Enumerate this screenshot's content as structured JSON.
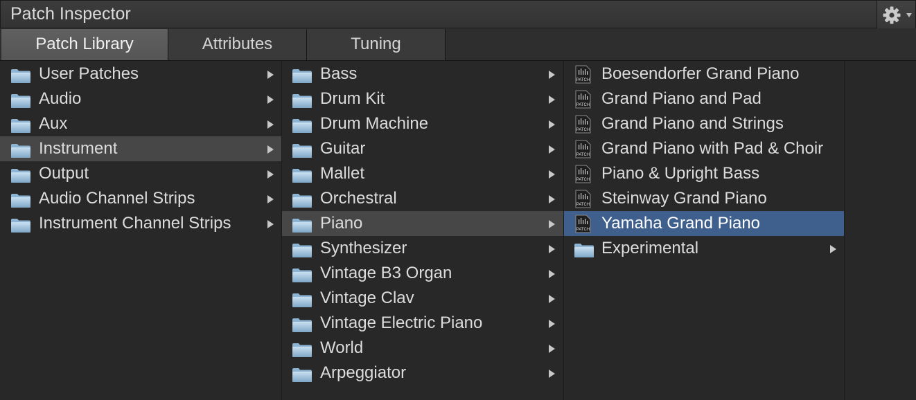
{
  "window": {
    "title": "Patch Inspector"
  },
  "tabs": [
    {
      "label": "Patch Library",
      "active": true
    },
    {
      "label": "Attributes",
      "active": false
    },
    {
      "label": "Tuning",
      "active": false
    }
  ],
  "columns": {
    "categories": [
      {
        "label": "User Patches",
        "icon": "folder-icon",
        "has_children": true
      },
      {
        "label": "Audio",
        "icon": "folder-icon",
        "has_children": true
      },
      {
        "label": "Aux",
        "icon": "folder-icon",
        "has_children": true
      },
      {
        "label": "Instrument",
        "icon": "folder-icon",
        "has_children": true,
        "selected": true
      },
      {
        "label": "Output",
        "icon": "folder-icon",
        "has_children": true
      },
      {
        "label": "Audio Channel Strips",
        "icon": "folder-icon",
        "has_children": true
      },
      {
        "label": "Instrument Channel Strips",
        "icon": "folder-icon",
        "has_children": true
      }
    ],
    "instruments": [
      {
        "label": "Bass",
        "icon": "folder-icon",
        "has_children": true
      },
      {
        "label": "Drum Kit",
        "icon": "folder-icon",
        "has_children": true
      },
      {
        "label": "Drum Machine",
        "icon": "folder-icon",
        "has_children": true
      },
      {
        "label": "Guitar",
        "icon": "folder-icon",
        "has_children": true
      },
      {
        "label": "Mallet",
        "icon": "folder-icon",
        "has_children": true
      },
      {
        "label": "Orchestral",
        "icon": "folder-icon",
        "has_children": true
      },
      {
        "label": "Piano",
        "icon": "folder-icon",
        "has_children": true,
        "selected": true
      },
      {
        "label": "Synthesizer",
        "icon": "folder-icon",
        "has_children": true
      },
      {
        "label": "Vintage B3 Organ",
        "icon": "folder-icon",
        "has_children": true
      },
      {
        "label": "Vintage Clav",
        "icon": "folder-icon",
        "has_children": true
      },
      {
        "label": "Vintage Electric Piano",
        "icon": "folder-icon",
        "has_children": true
      },
      {
        "label": "World",
        "icon": "folder-icon",
        "has_children": true
      },
      {
        "label": "Arpeggiator",
        "icon": "folder-icon",
        "has_children": true
      }
    ],
    "patches": [
      {
        "label": "Boesendorfer Grand Piano",
        "icon": "patch-file-icon",
        "has_children": false
      },
      {
        "label": "Grand Piano and Pad",
        "icon": "patch-file-icon",
        "has_children": false
      },
      {
        "label": "Grand Piano and Strings",
        "icon": "patch-file-icon",
        "has_children": false
      },
      {
        "label": "Grand Piano with Pad & Choir",
        "icon": "patch-file-icon",
        "has_children": false
      },
      {
        "label": "Piano & Upright Bass",
        "icon": "patch-file-icon",
        "has_children": false
      },
      {
        "label": "Steinway Grand Piano",
        "icon": "patch-file-icon",
        "has_children": false
      },
      {
        "label": "Yamaha Grand Piano",
        "icon": "patch-file-icon",
        "has_children": false,
        "selected": true
      },
      {
        "label": "Experimental",
        "icon": "folder-icon",
        "has_children": true
      }
    ]
  },
  "icons": {
    "settings": "gear-icon",
    "patch_badge_text": "PATCH"
  },
  "colors": {
    "background": "#282828",
    "selection_gray": "#474747",
    "selection_blue": "#3f5f8d",
    "text": "#dcdcdc"
  }
}
